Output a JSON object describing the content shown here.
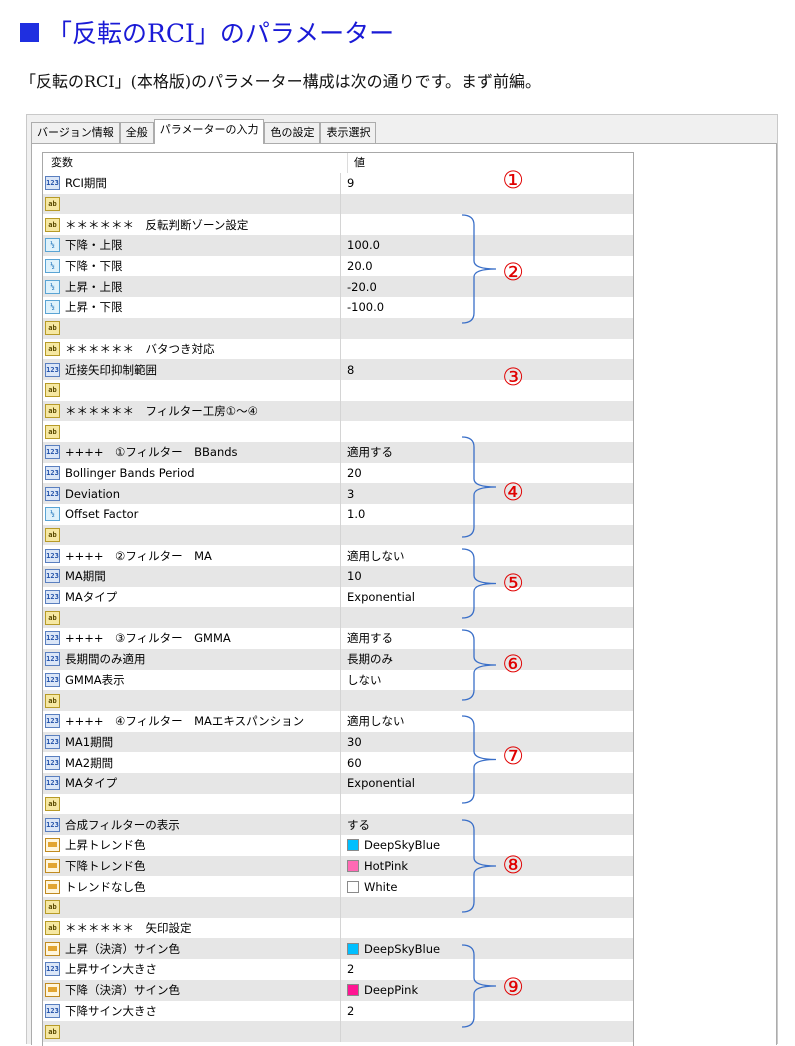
{
  "header": {
    "title": "「反転のRCI」のパラメーター"
  },
  "intro": {
    "text": "「反転のRCI」(本格版)のパラメーター構成は次の通りです。まず前編。"
  },
  "tabs": [
    {
      "label": "バージョン情報",
      "active": false
    },
    {
      "label": "全般",
      "active": false
    },
    {
      "label": "パラメーターの入力",
      "active": true
    },
    {
      "label": "色の設定",
      "active": false
    },
    {
      "label": "表示選択",
      "active": false
    }
  ],
  "columns": {
    "variable": "変数",
    "value": "値"
  },
  "rows": [
    {
      "icon": "123",
      "name": "RCI期間",
      "value": "9"
    },
    {
      "icon": "ab",
      "name": "",
      "value": ""
    },
    {
      "icon": "ab",
      "name": "＊＊＊＊＊＊　反転判断ゾーン設定",
      "value": ""
    },
    {
      "icon": "half",
      "name": "下降・上限",
      "value": "100.0"
    },
    {
      "icon": "half",
      "name": "下降・下限",
      "value": "20.0"
    },
    {
      "icon": "half",
      "name": "上昇・上限",
      "value": "-20.0"
    },
    {
      "icon": "half",
      "name": "上昇・下限",
      "value": "-100.0"
    },
    {
      "icon": "ab",
      "name": "",
      "value": ""
    },
    {
      "icon": "ab",
      "name": "＊＊＊＊＊＊　バタつき対応",
      "value": ""
    },
    {
      "icon": "123",
      "name": "近接矢印抑制範囲",
      "value": "8"
    },
    {
      "icon": "ab",
      "name": "",
      "value": ""
    },
    {
      "icon": "ab",
      "name": "＊＊＊＊＊＊　フィルター工房①～④",
      "value": ""
    },
    {
      "icon": "ab",
      "name": "",
      "value": ""
    },
    {
      "icon": "123",
      "name": "++++　①フィルター　BBands",
      "value": "適用する"
    },
    {
      "icon": "123",
      "name": "Bollinger Bands Period",
      "value": "20"
    },
    {
      "icon": "123",
      "name": "Deviation",
      "value": "3"
    },
    {
      "icon": "half",
      "name": "Offset Factor",
      "value": "1.0"
    },
    {
      "icon": "ab",
      "name": "",
      "value": ""
    },
    {
      "icon": "123",
      "name": "++++　②フィルター　MA",
      "value": "適用しない"
    },
    {
      "icon": "123",
      "name": "MA期間",
      "value": "10"
    },
    {
      "icon": "123",
      "name": "MAタイプ",
      "value": "Exponential"
    },
    {
      "icon": "ab",
      "name": "",
      "value": ""
    },
    {
      "icon": "123",
      "name": "++++　③フィルター　GMMA",
      "value": "適用する"
    },
    {
      "icon": "123",
      "name": "長期間のみ適用",
      "value": "長期のみ"
    },
    {
      "icon": "123",
      "name": "GMMA表示",
      "value": "しない"
    },
    {
      "icon": "ab",
      "name": "",
      "value": ""
    },
    {
      "icon": "123",
      "name": "++++　④フィルター　MAエキスパンション",
      "value": "適用しない"
    },
    {
      "icon": "123",
      "name": "MA1期間",
      "value": "30"
    },
    {
      "icon": "123",
      "name": "MA2期間",
      "value": "60"
    },
    {
      "icon": "123",
      "name": "MAタイプ",
      "value": "Exponential"
    },
    {
      "icon": "ab",
      "name": "",
      "value": ""
    },
    {
      "icon": "123",
      "name": "合成フィルターの表示",
      "value": "する"
    },
    {
      "icon": "color",
      "name": "上昇トレンド色",
      "value": "DeepSkyBlue",
      "swatch": "#00bfff"
    },
    {
      "icon": "color",
      "name": "下降トレンド色",
      "value": "HotPink",
      "swatch": "#ff69b4"
    },
    {
      "icon": "color",
      "name": "トレンドなし色",
      "value": "White",
      "swatch": "#ffffff"
    },
    {
      "icon": "ab",
      "name": "",
      "value": ""
    },
    {
      "icon": "ab",
      "name": "＊＊＊＊＊＊　矢印設定",
      "value": ""
    },
    {
      "icon": "color",
      "name": "上昇（決済）サイン色",
      "value": "DeepSkyBlue",
      "swatch": "#00bfff"
    },
    {
      "icon": "123",
      "name": "上昇サイン大きさ",
      "value": "2"
    },
    {
      "icon": "color",
      "name": "下降（決済）サイン色",
      "value": "DeepPink",
      "swatch": "#ff1493"
    },
    {
      "icon": "123",
      "name": "下降サイン大きさ",
      "value": "2"
    },
    {
      "icon": "ab",
      "name": "",
      "value": ""
    }
  ],
  "annotations": [
    "①",
    "②",
    "③",
    "④",
    "⑤",
    "⑥",
    "⑦",
    "⑧",
    "⑨"
  ],
  "colors": {
    "title": "#1a1ad6",
    "annotation": "#e00000",
    "bracket": "#3a6fc8"
  }
}
